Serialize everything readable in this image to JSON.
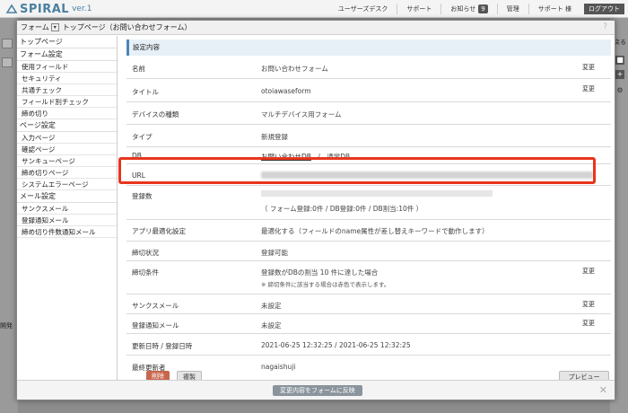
{
  "app": {
    "logo_text": "SPIRAL",
    "version": "ver.1"
  },
  "topnav": {
    "items": [
      "ユーザーズデスク",
      "サポート",
      "お知らせ",
      "管理",
      "サポート 様"
    ],
    "notice_count": "9",
    "logout": "ログアウト"
  },
  "background": {
    "tab_label": "開発",
    "right_text": "戻る"
  },
  "modal": {
    "form_label": "フォーム",
    "breadcrumb": "トップページ（お問い合わせフォーム）",
    "help": "?"
  },
  "sidebar": {
    "groups": [
      {
        "head": "トップページ",
        "items": []
      },
      {
        "head": "フォーム設定",
        "items": [
          "使用フィールド",
          "セキュリティ",
          "共通チェック",
          "フィールド別チェック",
          "締め切り"
        ]
      },
      {
        "head": "ページ設定",
        "items": [
          "入力ページ",
          "確認ページ",
          "サンキューページ",
          "締め切りページ",
          "システムエラーページ"
        ]
      },
      {
        "head": "メール設定",
        "items": [
          "サンクスメール",
          "登録通知メール",
          "締め切り件数通知メール"
        ]
      }
    ]
  },
  "main": {
    "section_title": "設定内容",
    "edit_label": "変更",
    "rows": {
      "name": {
        "label": "名前",
        "value": "お問い合わせフォーム"
      },
      "title": {
        "label": "タイトル",
        "value": "otoiawaseform"
      },
      "device": {
        "label": "デバイスの種類",
        "value": "マルチデバイス用フォーム"
      },
      "type": {
        "label": "タイプ",
        "value": "新規登録"
      },
      "db": {
        "label": "DB",
        "value_link": "お問い合わせDB",
        "sep": "/",
        "value_type": "通常DB"
      },
      "url": {
        "label": "URL"
      },
      "count": {
        "label": "登録数",
        "value": "（ フォーム登録:0件 / DB登録:0件 / DB割当:10件 ）"
      },
      "optimize": {
        "label": "アプリ最適化設定",
        "value": "最適化する（フィールドのname属性が差し替えキーワードで動作します）"
      },
      "deadline_status": {
        "label": "締切状況",
        "value": "登録可能"
      },
      "deadline_cond": {
        "label": "締切条件",
        "value": "登録数がDBの割当 10 件に達した場合",
        "note": "※ 締切条件に該当する場合は赤色で表示します。"
      },
      "thanks_mail": {
        "label": "サンクスメール",
        "value": "未設定"
      },
      "notify_mail": {
        "label": "登録通知メール",
        "value": "未設定"
      },
      "updated": {
        "label": "更新日時 / 登録日時",
        "value": "2021-06-25 12:32:25 / 2021-06-25 12:32:25"
      },
      "last_updater": {
        "label": "最終更新者",
        "value": "nagaishuji"
      }
    },
    "buttons": {
      "delete": "削除",
      "copy": "複製",
      "preview": "プレビュー"
    }
  },
  "footer": {
    "apply": "変更内容をフォームに反映",
    "close": "✕"
  },
  "colors": {
    "highlight": "#e8351d",
    "accent": "#4a86b8"
  }
}
